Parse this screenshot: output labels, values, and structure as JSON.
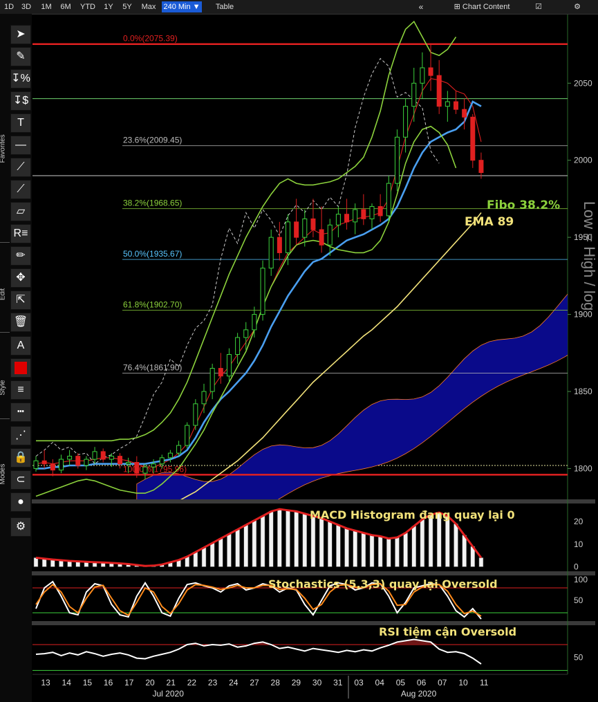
{
  "topbar": {
    "ranges": [
      {
        "label": "1D",
        "active": false
      },
      {
        "label": "3D",
        "active": false
      },
      {
        "label": "1M",
        "active": false
      },
      {
        "label": "6M",
        "active": false
      },
      {
        "label": "YTD",
        "active": false
      },
      {
        "label": "1Y",
        "active": false
      },
      {
        "label": "5Y",
        "active": false
      },
      {
        "label": "Max",
        "active": false
      },
      {
        "label": "240 Min ▼",
        "active": true
      },
      {
        "label": "Table",
        "active": false
      }
    ],
    "collapse_icon": "«",
    "chart_content_label": "Chart Content",
    "edit_icon": "☑",
    "settings_icon": "⚙"
  },
  "toolbar": {
    "sections": [
      "Favorites",
      "Edit",
      "Style",
      "Modes"
    ],
    "tools": [
      {
        "name": "pointer-tool",
        "glyph": "➤"
      },
      {
        "name": "pencil-tool",
        "glyph": "✎"
      },
      {
        "name": "percent-tool",
        "glyph": "↧%"
      },
      {
        "name": "dollar-tool",
        "glyph": "↧$"
      },
      {
        "name": "text-tool",
        "glyph": "T"
      },
      {
        "name": "horizontal-line-tool",
        "glyph": "—"
      },
      {
        "name": "trend-line-tool",
        "glyph": "⟋"
      },
      {
        "name": "ray-line-tool",
        "glyph": "⟋"
      },
      {
        "name": "channel-tool",
        "glyph": "▱"
      },
      {
        "name": "r-fibo-tool",
        "glyph": "R≡"
      },
      {
        "name": "draw-tool",
        "glyph": "✏"
      },
      {
        "name": "move-tool",
        "glyph": "✥"
      },
      {
        "name": "add-pointer-tool",
        "glyph": "⇱"
      },
      {
        "name": "trash-tool",
        "glyph": "🗑"
      },
      {
        "name": "font-tool",
        "glyph": "A"
      },
      {
        "name": "color-tool",
        "glyph": ""
      },
      {
        "name": "line-weight-tool",
        "glyph": "≡"
      },
      {
        "name": "line-style-tool",
        "glyph": "┅"
      },
      {
        "name": "dotted-mode-tool",
        "glyph": "⋰"
      },
      {
        "name": "lock-mode-tool",
        "glyph": "🔒"
      },
      {
        "name": "magnet-mode-tool",
        "glyph": "⊂"
      },
      {
        "name": "multi-color-mode-tool",
        "glyph": "●"
      },
      {
        "name": "settings-tool",
        "glyph": "⚙"
      }
    ]
  },
  "colors": {
    "candle_up": "#3cd23c",
    "candle_down": "#e02020",
    "ema": "#f2e27a",
    "kumo": "#0a0a8a",
    "tenkan": "#e02020",
    "kijun": "#4a9ff0",
    "bollinger": "#8cd23c",
    "chikou": "#cccccc",
    "fibo_red": "#e02020"
  },
  "chart_data": [
    {
      "type": "line",
      "panel": "price",
      "y_axis_title": "Low = High / log",
      "ylim": [
        1780,
        2095
      ],
      "y_ticks": [
        1800,
        1850,
        1900,
        1950,
        2000,
        2050
      ],
      "x_ticks": [
        "13",
        "14",
        "15",
        "16",
        "17",
        "20",
        "21",
        "22",
        "23",
        "24",
        "27",
        "28",
        "29",
        "30",
        "31",
        "03",
        "04",
        "05",
        "06",
        "07",
        "10",
        "11"
      ],
      "x_month_labels": [
        {
          "label": "Jul 2020",
          "at": "21"
        },
        {
          "label": "Aug 2020",
          "at": "06"
        }
      ],
      "fibonacci_levels": [
        {
          "label": "0.0%(2075.39)",
          "value": 2075.39,
          "color": "#e02020"
        },
        {
          "label": "23.6%(2009.45)",
          "value": 2009.45,
          "color": "#bbbbbb"
        },
        {
          "label": "38.2%(1968.65)",
          "value": 1968.65,
          "color": "#8cd23c"
        },
        {
          "label": "50.0%(1935.67)",
          "value": 1935.67,
          "color": "#59c6ff"
        },
        {
          "label": "61.8%(1902.70)",
          "value": 1902.7,
          "color": "#8cd23c"
        },
        {
          "label": "76.4%(1861.90)",
          "value": 1861.9,
          "color": "#bbbbbb"
        },
        {
          "label": "100.0%(1795.96)",
          "value": 1795.96,
          "color": "#e02020"
        }
      ],
      "horizontal_lines": [
        2040,
        1990,
        1802
      ],
      "candles": [
        [
          1800,
          1808,
          1798,
          1805
        ],
        [
          1805,
          1812,
          1800,
          1803
        ],
        [
          1803,
          1806,
          1795,
          1799
        ],
        [
          1799,
          1809,
          1797,
          1806
        ],
        [
          1806,
          1812,
          1802,
          1808
        ],
        [
          1808,
          1810,
          1800,
          1802
        ],
        [
          1802,
          1808,
          1799,
          1806
        ],
        [
          1806,
          1814,
          1803,
          1811
        ],
        [
          1811,
          1813,
          1804,
          1806
        ],
        [
          1806,
          1810,
          1801,
          1808
        ],
        [
          1808,
          1810,
          1800,
          1803
        ],
        [
          1803,
          1807,
          1797,
          1804
        ],
        [
          1804,
          1808,
          1794,
          1797
        ],
        [
          1797,
          1803,
          1793,
          1801
        ],
        [
          1801,
          1806,
          1797,
          1803
        ],
        [
          1803,
          1809,
          1800,
          1807
        ],
        [
          1807,
          1812,
          1804,
          1810
        ],
        [
          1810,
          1818,
          1808,
          1815
        ],
        [
          1815,
          1830,
          1813,
          1828
        ],
        [
          1828,
          1845,
          1825,
          1842
        ],
        [
          1842,
          1855,
          1836,
          1850
        ],
        [
          1850,
          1868,
          1845,
          1865
        ],
        [
          1865,
          1875,
          1855,
          1860
        ],
        [
          1860,
          1878,
          1856,
          1874
        ],
        [
          1874,
          1888,
          1868,
          1885
        ],
        [
          1885,
          1895,
          1877,
          1890
        ],
        [
          1890,
          1905,
          1885,
          1900
        ],
        [
          1900,
          1935,
          1896,
          1930
        ],
        [
          1930,
          1955,
          1925,
          1950
        ],
        [
          1950,
          1960,
          1935,
          1940
        ],
        [
          1940,
          1965,
          1932,
          1960
        ],
        [
          1960,
          1975,
          1945,
          1950
        ],
        [
          1950,
          1968,
          1944,
          1962
        ],
        [
          1962,
          1975,
          1950,
          1955
        ],
        [
          1955,
          1970,
          1940,
          1945
        ],
        [
          1945,
          1962,
          1938,
          1958
        ],
        [
          1958,
          1970,
          1950,
          1965
        ],
        [
          1965,
          1975,
          1955,
          1960
        ],
        [
          1960,
          1972,
          1952,
          1968
        ],
        [
          1968,
          1978,
          1958,
          1962
        ],
        [
          1962,
          1972,
          1955,
          1970
        ],
        [
          1970,
          1978,
          1960,
          1964
        ],
        [
          1964,
          1990,
          1960,
          1985
        ],
        [
          1985,
          2020,
          1980,
          2015
        ],
        [
          2015,
          2040,
          2005,
          2035
        ],
        [
          2035,
          2060,
          2025,
          2050
        ],
        [
          2050,
          2070,
          2040,
          2060
        ],
        [
          2060,
          2075,
          2045,
          2055
        ],
        [
          2055,
          2065,
          2030,
          2035
        ],
        [
          2035,
          2045,
          2025,
          2038
        ],
        [
          2038,
          2045,
          2030,
          2033
        ],
        [
          2033,
          2040,
          2020,
          2028
        ],
        [
          2028,
          2030,
          1995,
          2000
        ],
        [
          2000,
          2005,
          1988,
          1992
        ]
      ],
      "series": [
        {
          "name": "EMA 89",
          "values": [
            1745,
            1747,
            1749,
            1751,
            1753,
            1755,
            1757,
            1759,
            1761,
            1763,
            1765,
            1767,
            1769,
            1771,
            1773,
            1775,
            1777,
            1779,
            1782,
            1785,
            1789,
            1793,
            1797,
            1801,
            1805,
            1810,
            1815,
            1820,
            1826,
            1832,
            1838,
            1844,
            1850,
            1856,
            1861,
            1866,
            1871,
            1876,
            1881,
            1886,
            1890,
            1895,
            1900,
            1905,
            1911,
            1917,
            1923,
            1929,
            1935,
            1941,
            1947,
            1953,
            1959,
            1966
          ]
        },
        {
          "name": "Tenkan",
          "values": [
            1803,
            1804,
            1803,
            1804,
            1805,
            1805,
            1805,
            1806,
            1807,
            1807,
            1806,
            1805,
            1803,
            1801,
            1801,
            1803,
            1806,
            1810,
            1816,
            1828,
            1840,
            1852,
            1860,
            1866,
            1874,
            1882,
            1890,
            1905,
            1918,
            1930,
            1940,
            1945,
            1950,
            1955,
            1952,
            1953,
            1958,
            1960,
            1962,
            1963,
            1964,
            1966,
            1975,
            1995,
            2015,
            2030,
            2045,
            2053,
            2052,
            2050,
            2045,
            2043,
            2035,
            2012
          ]
        },
        {
          "name": "Kijun",
          "values": [
            1800,
            1800,
            1801,
            1801,
            1802,
            1802,
            1802,
            1803,
            1803,
            1803,
            1803,
            1803,
            1803,
            1803,
            1804,
            1805,
            1806,
            1808,
            1812,
            1820,
            1830,
            1838,
            1845,
            1850,
            1856,
            1862,
            1870,
            1880,
            1892,
            1902,
            1912,
            1920,
            1928,
            1934,
            1936,
            1940,
            1944,
            1948,
            1950,
            1952,
            1955,
            1958,
            1962,
            1970,
            1982,
            1995,
            2005,
            2012,
            2015,
            2018,
            2020,
            2025,
            2038,
            2035
          ]
        },
        {
          "name": "BB upper",
          "values": [
            1818,
            1818,
            1818,
            1818,
            1818,
            1818,
            1818,
            1818,
            1818,
            1818,
            1819,
            1819,
            1820,
            1822,
            1825,
            1830,
            1836,
            1845,
            1856,
            1870,
            1884,
            1898,
            1912,
            1926,
            1938,
            1950,
            1960,
            1970,
            1978,
            1985,
            1988,
            1985,
            1984,
            1984,
            1985,
            1986,
            1988,
            1992,
            1996,
            2002,
            2015,
            2032,
            2055,
            2072,
            2085,
            2090,
            2080,
            2070,
            2068,
            2072,
            2080
          ]
        },
        {
          "name": "BB lower",
          "values": [
            1782,
            1784,
            1786,
            1788,
            1790,
            1792,
            1793,
            1792,
            1790,
            1788,
            1786,
            1785,
            1784,
            1784,
            1786,
            1790,
            1795,
            1800,
            1808,
            1816,
            1825,
            1836,
            1846,
            1856,
            1866,
            1876,
            1890,
            1905,
            1918,
            1928,
            1938,
            1945,
            1947,
            1948,
            1947,
            1944,
            1942,
            1941,
            1940,
            1940,
            1942,
            1948,
            1960,
            1978,
            1998,
            2012,
            2020,
            2022,
            2018,
            2010,
            1995
          ]
        }
      ],
      "annotations": [
        {
          "text": "Fibo 38.2%",
          "color": "#8cd23c"
        },
        {
          "text": "EMA 89",
          "color": "#f2e27a"
        }
      ]
    },
    {
      "type": "bar",
      "panel": "MACD",
      "title": "MACD Histogram đang quay lại 0",
      "ylim": [
        -2,
        28
      ],
      "y_ticks": [
        0,
        10,
        20
      ],
      "values": [
        4,
        3.6,
        3.2,
        2.9,
        2.6,
        2.4,
        2.2,
        2,
        1.9,
        1.7,
        1.5,
        1.2,
        0.8,
        0.4,
        0.5,
        1,
        2,
        3,
        4.5,
        6.5,
        8.5,
        10.5,
        12.5,
        14.5,
        16.5,
        18.5,
        20.5,
        22.5,
        24.5,
        25.5,
        25,
        24.5,
        23.5,
        22.5,
        21.5,
        20,
        18.5,
        17,
        16,
        15,
        14,
        13.5,
        12.5,
        13,
        15,
        18,
        21,
        23,
        24,
        22.5,
        19,
        14,
        9,
        4
      ]
    },
    {
      "type": "line",
      "panel": "Stochastics",
      "title": "Stochastics (5,3,3) quay lại Oversold",
      "ylim": [
        0,
        110
      ],
      "y_ticks": [
        50,
        100
      ],
      "series": [
        {
          "name": "%K",
          "values": [
            30,
            80,
            95,
            60,
            20,
            15,
            70,
            90,
            85,
            40,
            15,
            10,
            60,
            92,
            60,
            20,
            12,
            55,
            88,
            92,
            85,
            80,
            70,
            85,
            90,
            75,
            80,
            90,
            85,
            70,
            80,
            75,
            40,
            15,
            50,
            85,
            92,
            88,
            75,
            80,
            92,
            90,
            60,
            20,
            45,
            80,
            85,
            90,
            88,
            60,
            25,
            10,
            30,
            5
          ]
        },
        {
          "name": "%D",
          "values": [
            40,
            70,
            88,
            70,
            35,
            20,
            55,
            82,
            86,
            55,
            25,
            14,
            45,
            80,
            70,
            35,
            18,
            42,
            75,
            88,
            86,
            82,
            76,
            80,
            86,
            80,
            80,
            86,
            86,
            76,
            78,
            76,
            55,
            28,
            40,
            70,
            86,
            88,
            82,
            80,
            88,
            90,
            72,
            38,
            40,
            70,
            82,
            87,
            88,
            72,
            40,
            18,
            24,
            12
          ]
        }
      ]
    },
    {
      "type": "line",
      "panel": "RSI",
      "title": "RSI tiệm cận Oversold",
      "ylim": [
        25,
        100
      ],
      "y_ticks": [
        50
      ],
      "values": [
        55,
        56,
        58,
        53,
        57,
        54,
        59,
        56,
        52,
        55,
        57,
        54,
        49,
        48,
        52,
        55,
        58,
        63,
        70,
        72,
        68,
        70,
        69,
        71,
        66,
        68,
        72,
        74,
        70,
        64,
        66,
        63,
        60,
        64,
        62,
        60,
        58,
        61,
        59,
        62,
        60,
        65,
        69,
        74,
        76,
        78,
        76,
        74,
        63,
        58,
        59,
        56,
        49,
        40
      ]
    }
  ]
}
